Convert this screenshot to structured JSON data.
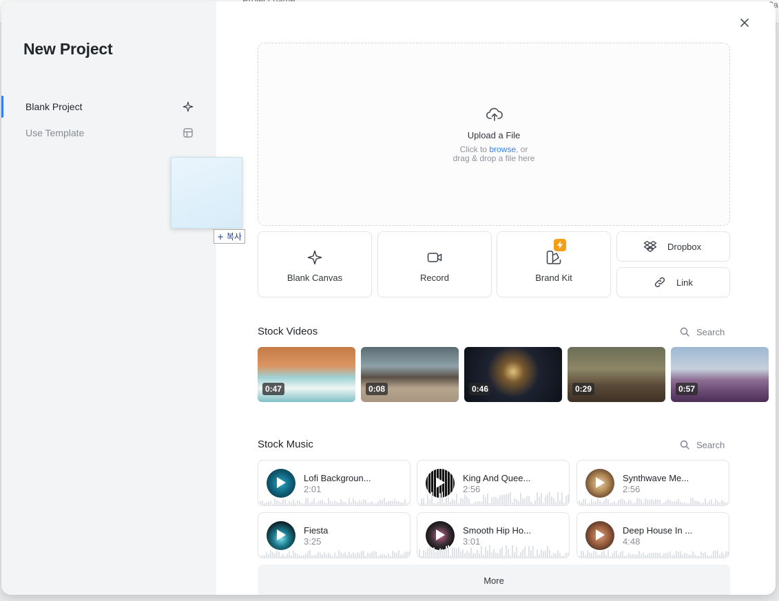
{
  "background": {
    "title": "Project name",
    "corner": "Sa"
  },
  "modal": {
    "title": "New Project",
    "close_icon": "close-icon",
    "sidebar": [
      {
        "label": "Blank Project",
        "icon": "sparkle-icon",
        "active": true
      },
      {
        "label": "Use Template",
        "icon": "template-icon",
        "active": false
      }
    ],
    "drag_tooltip": "+ 복사",
    "upload": {
      "title": "Upload a File",
      "line1_prefix": "Click to ",
      "line1_link": "browse",
      "line1_suffix": ", or",
      "line2": "drag & drop a file here"
    },
    "tiles": {
      "blank_canvas": "Blank Canvas",
      "record": "Record",
      "brand_kit": "Brand Kit",
      "dropbox": "Dropbox",
      "link": "Link"
    },
    "stock_videos": {
      "title": "Stock Videos",
      "search": "Search",
      "items": [
        {
          "duration": "0:47"
        },
        {
          "duration": "0:08"
        },
        {
          "duration": "0:46"
        },
        {
          "duration": "0:29"
        },
        {
          "duration": "0:57"
        }
      ]
    },
    "stock_music": {
      "title": "Stock Music",
      "search": "Search",
      "items": [
        {
          "title": "Lofi Backgroun...",
          "duration": "2:01"
        },
        {
          "title": "King And Quee...",
          "duration": "2:56"
        },
        {
          "title": "Synthwave Me...",
          "duration": "2:56"
        },
        {
          "title": "Fiesta",
          "duration": "3:25"
        },
        {
          "title": "Smooth Hip Ho...",
          "duration": "3:01"
        },
        {
          "title": "Deep House In ...",
          "duration": "4:48"
        }
      ]
    },
    "more": "More"
  },
  "colors": {
    "accent": "#2f7ef5",
    "badge": "#f59f16",
    "sidebar_bg": "#f3f4f5"
  }
}
